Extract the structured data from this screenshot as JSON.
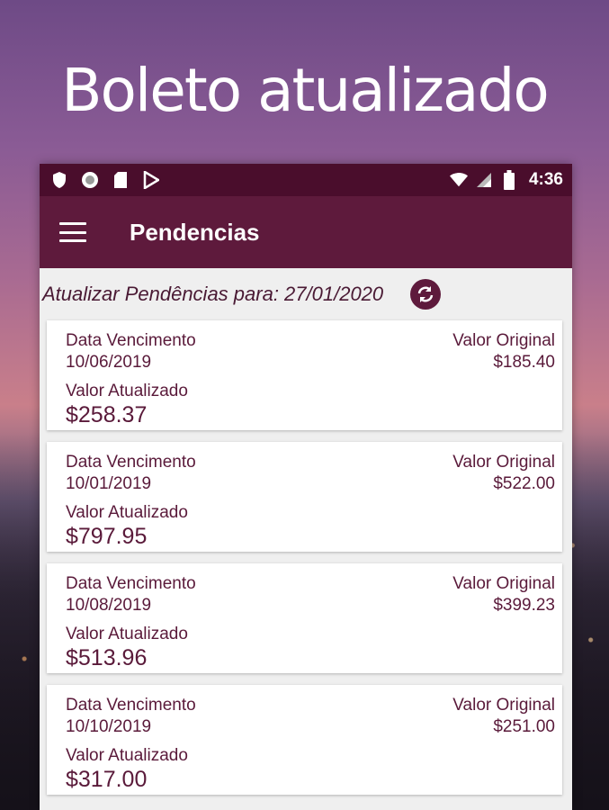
{
  "headline": "Boleto atualizado",
  "statusbar": {
    "time": "4:36",
    "left_icons": [
      "shield-icon",
      "circle-icon",
      "sd-card-icon",
      "play-store-icon"
    ],
    "right_icons": [
      "wifi-icon",
      "signal-icon",
      "battery-icon"
    ]
  },
  "appbar": {
    "title": "Pendencias",
    "menu_icon": "hamburger-menu-icon"
  },
  "update": {
    "label": "Atualizar Pendências para: 27/01/2020",
    "icon": "refresh-icon"
  },
  "labels": {
    "due_date": "Data Vencimento",
    "updated_value": "Valor Atualizado",
    "original_value": "Valor Original"
  },
  "items": [
    {
      "due_date": "10/06/2019",
      "updated_value": "$258.37",
      "original_value": "$185.40"
    },
    {
      "due_date": "10/01/2019",
      "updated_value": "$797.95",
      "original_value": "$522.00"
    },
    {
      "due_date": "10/08/2019",
      "updated_value": "$513.96",
      "original_value": "$399.23"
    },
    {
      "due_date": "10/10/2019",
      "updated_value": "$317.00",
      "original_value": "$251.00"
    }
  ],
  "colors": {
    "statusbar": "#4a0d2c",
    "appbar": "#5e1a3c",
    "text": "#5a1a3a"
  }
}
